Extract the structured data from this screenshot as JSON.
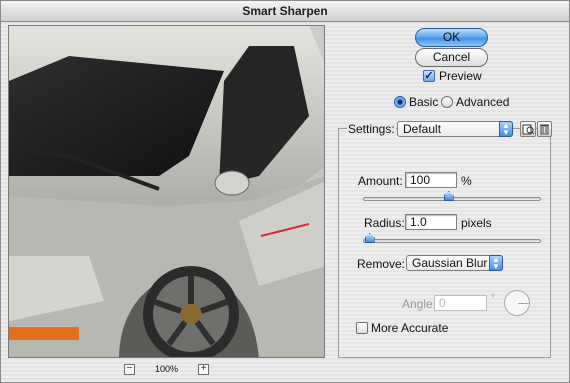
{
  "window": {
    "title": "Smart Sharpen"
  },
  "preview": {
    "zoom_value": "100%",
    "zoom_out_icon": "minus-icon",
    "zoom_in_icon": "plus-icon"
  },
  "buttons": {
    "ok_label": "OK",
    "cancel_label": "Cancel"
  },
  "preview_toggle": {
    "label": "Preview",
    "checked": true
  },
  "mode": {
    "basic_label": "Basic",
    "advanced_label": "Advanced",
    "selected": "Basic"
  },
  "settings": {
    "label": "Settings:",
    "selected": "Default",
    "save_icon": "save-settings-icon",
    "delete_icon": "trash-icon"
  },
  "amount": {
    "label": "Amount:",
    "value": "100",
    "unit": "%",
    "level": 0.48
  },
  "radius": {
    "label": "Radius:",
    "value": "1.0",
    "unit": "pixels",
    "level": 0.01
  },
  "remove": {
    "label": "Remove:",
    "selected": "Gaussian Blur"
  },
  "angle": {
    "label": "Angle:",
    "value": "0",
    "unit": "°"
  },
  "more_accurate": {
    "label": "More Accurate",
    "checked": false
  },
  "colors": {
    "accent": "#3d8ee6",
    "car_body": "#c9c9c4"
  }
}
